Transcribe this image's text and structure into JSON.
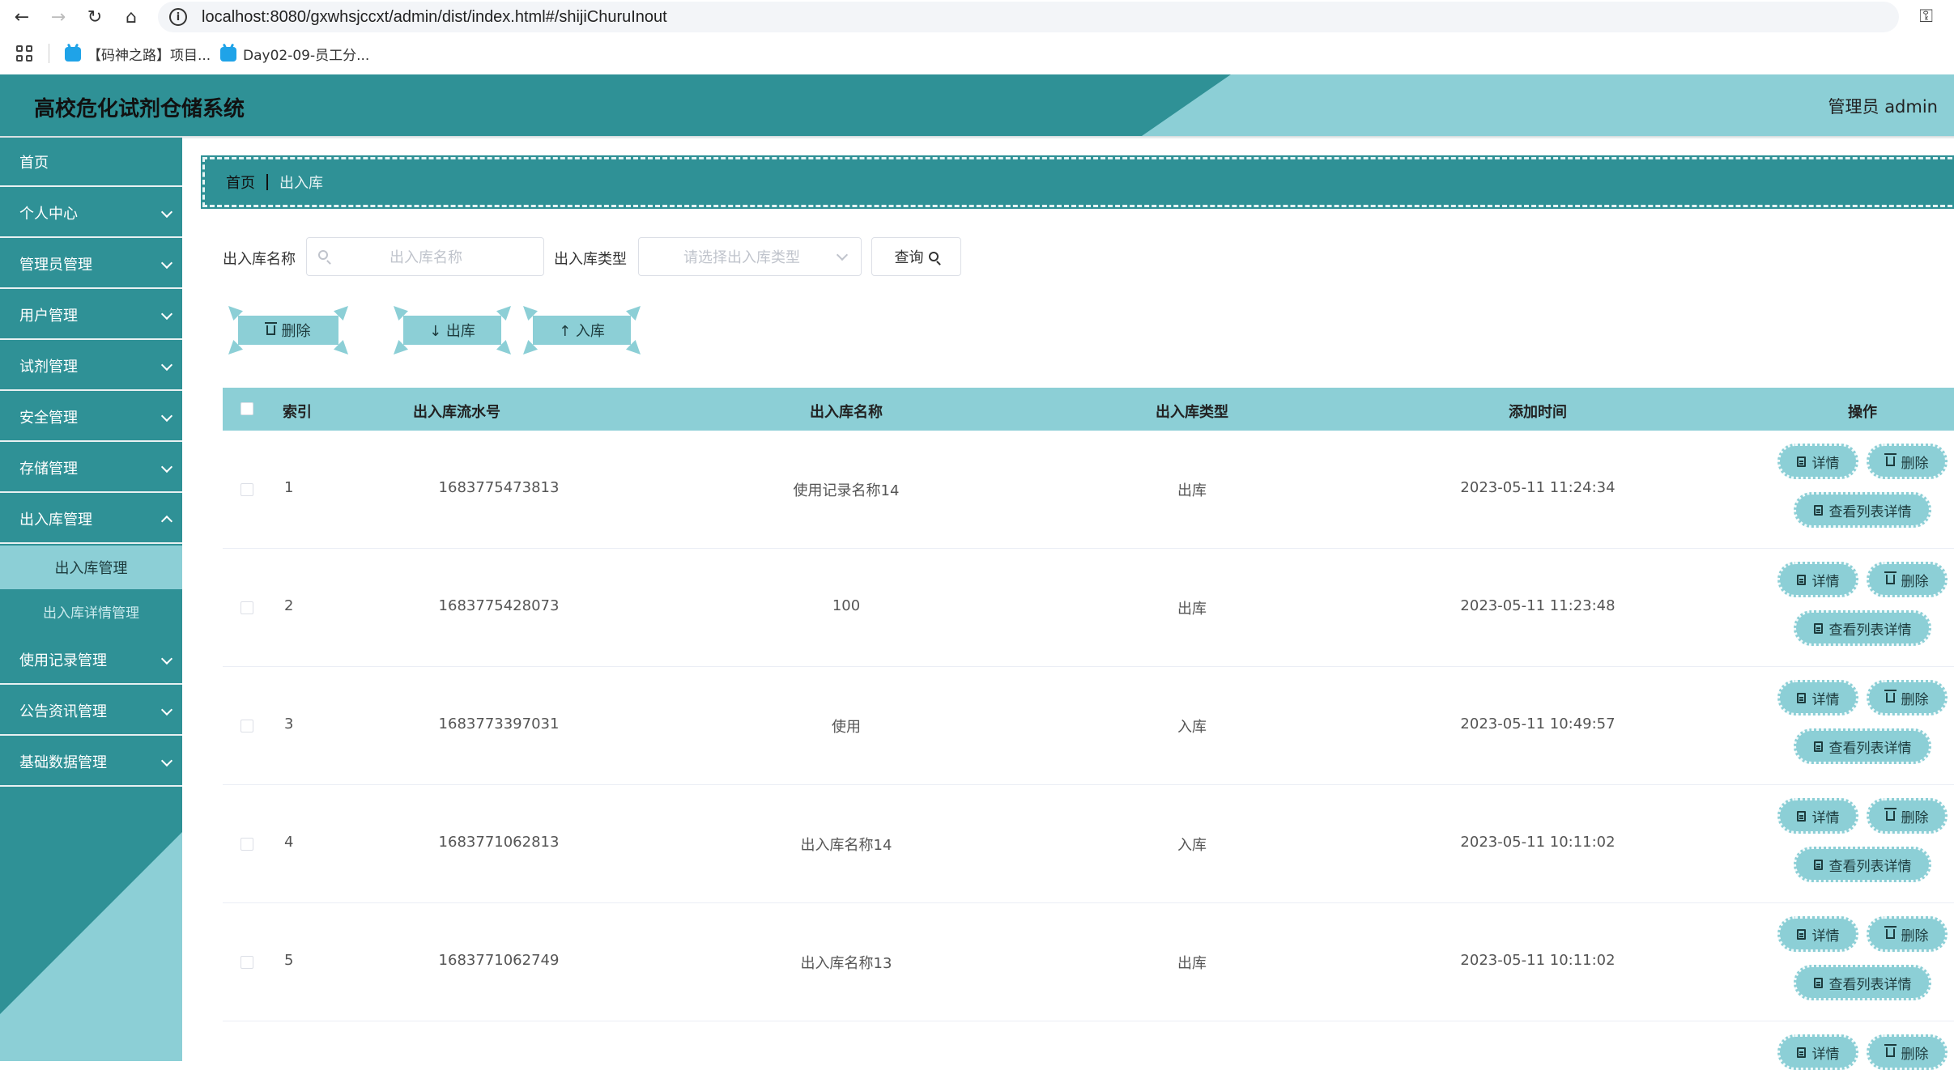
{
  "browser": {
    "url": "localhost:8080/gxwhsjccxt/admin/dist/index.html#/shijiChuruInout",
    "bookmarks": [
      "【码神之路】项目...",
      "Day02-09-员工分..."
    ]
  },
  "header": {
    "title": "高校危化试剂仓储系统",
    "user": "管理员 admin"
  },
  "sidebar": {
    "items": [
      {
        "label": "首页"
      },
      {
        "label": "个人中心"
      },
      {
        "label": "管理员管理"
      },
      {
        "label": "用户管理"
      },
      {
        "label": "试剂管理"
      },
      {
        "label": "安全管理"
      },
      {
        "label": "存储管理"
      },
      {
        "label": "出入库管理"
      },
      {
        "label": "使用记录管理"
      },
      {
        "label": "公告资讯管理"
      },
      {
        "label": "基础数据管理"
      }
    ],
    "sub_items": [
      {
        "label": "出入库管理"
      },
      {
        "label": "出入库详情管理"
      }
    ]
  },
  "breadcrumb": {
    "home": "首页",
    "current": "出入库"
  },
  "search": {
    "name_label": "出入库名称",
    "name_placeholder": "出入库名称",
    "type_label": "出入库类型",
    "type_placeholder": "请选择出入库类型",
    "query_label": "查询"
  },
  "actions": {
    "delete": "删除",
    "out": "↓ 出库",
    "in": "↑ 入库"
  },
  "table": {
    "columns": [
      "索引",
      "出入库流水号",
      "出入库名称",
      "出入库类型",
      "添加时间",
      "操作"
    ],
    "rows": [
      {
        "index": "1",
        "serial": "1683775473813",
        "name": "使用记录名称14",
        "type": "出库",
        "time": "2023-05-11 11:24:34"
      },
      {
        "index": "2",
        "serial": "1683775428073",
        "name": "100",
        "type": "出库",
        "time": "2023-05-11 11:23:48"
      },
      {
        "index": "3",
        "serial": "1683773397031",
        "name": "使用",
        "type": "入库",
        "time": "2023-05-11 10:49:57"
      },
      {
        "index": "4",
        "serial": "1683771062813",
        "name": "出入库名称14",
        "type": "入库",
        "time": "2023-05-11 10:11:02"
      },
      {
        "index": "5",
        "serial": "1683771062749",
        "name": "出入库名称13",
        "type": "出库",
        "time": "2023-05-11 10:11:02"
      }
    ],
    "op_detail": "详情",
    "op_delete": "删除",
    "op_list_detail": "查看列表详情"
  }
}
